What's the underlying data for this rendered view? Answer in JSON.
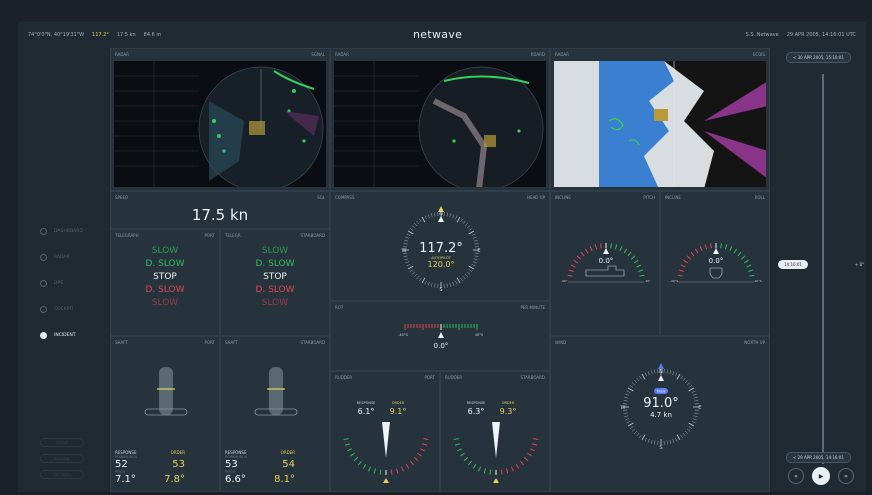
{
  "topbar": {
    "position": "74°0'0\"N, 40°19'31\"W",
    "heading": "117.2°",
    "speed": "17.5 kn",
    "depth": "84.6 m",
    "brand": "netwave",
    "vessel": "S.S. Netwave",
    "datetime": "29 APR 2005, 14:16:01 UTC"
  },
  "sidebar": {
    "items": [
      {
        "label": "DASHBOARD"
      },
      {
        "label": "RADAR"
      },
      {
        "label": "DPS"
      },
      {
        "label": "COCKPIT"
      },
      {
        "label": "INCIDENT"
      }
    ],
    "buttons": [
      "EVENT",
      "SECOND",
      "SETTINGS"
    ]
  },
  "radar": [
    {
      "title": "RADAR",
      "mode": "SGNAL"
    },
    {
      "title": "RADAR",
      "mode": "RDARD"
    },
    {
      "title": "RADAR",
      "mode": "ECDIS"
    }
  ],
  "speed": {
    "title": "SPEED",
    "ref": "SGL",
    "value": "17.5 kn"
  },
  "telegraph_port": {
    "title": "TELEGRAPH",
    "side": "PORT",
    "items": [
      "SLOW",
      "D. SLOW",
      "STOP",
      "D. SLOW",
      "SLOW"
    ]
  },
  "telegraph_stbd": {
    "title": "TELEGR.",
    "side": "STARBOARD",
    "items": [
      "SLOW",
      "D. SLOW",
      "STOP",
      "D. SLOW",
      "SLOW"
    ]
  },
  "compass": {
    "title": "COMPASS",
    "mode": "HEAD UP",
    "heading": "117.2°",
    "autopilot_label": "AUTOPILOT",
    "autopilot": "120.0°",
    "n": "N",
    "s": "S",
    "e": "E",
    "w": "W"
  },
  "rot": {
    "title": "ROT",
    "unit": "PER MINUTE",
    "value": "0.0°",
    "left": "-40°S",
    "right": "40°S"
  },
  "incline_pitch": {
    "title": "INCLINE",
    "mode": "PITCH",
    "value": "0.0°",
    "left": "-40°",
    "right": "40°"
  },
  "incline_roll": {
    "title": "INCLINE",
    "mode": "ROLL",
    "value": "0.0°",
    "left": "-40°S",
    "right": "40°S"
  },
  "shaft_port": {
    "title": "SHAFT",
    "side": "PORT",
    "response_label": "RESPONSE",
    "order_label": "ORDER",
    "power_label": "POWER IN %",
    "pitch_label": "PITCH",
    "power_resp": "52",
    "power_order": "53",
    "pitch_resp": "7.1°",
    "pitch_order": "7.8°"
  },
  "shaft_stbd": {
    "title": "SHAFT",
    "side": "STARBOARD",
    "response_label": "RESPONSE",
    "order_label": "ORDER",
    "power_label": "POWER IN %",
    "pitch_label": "PITCH",
    "power_resp": "53",
    "power_order": "54",
    "pitch_resp": "6.6°",
    "pitch_order": "8.1°"
  },
  "rudder_port": {
    "title": "RUDDER",
    "side": "PORT",
    "response_label": "RESPONSE",
    "order_label": "ORDER",
    "response": "6.1°",
    "order": "9.1°"
  },
  "rudder_stbd": {
    "title": "RUDDER",
    "side": "STARBOARD",
    "response_label": "RESPONSE",
    "order_label": "ORDER",
    "response": "6.3°",
    "order": "9.3°"
  },
  "wind": {
    "title": "WIND",
    "mode": "NORTH UP",
    "direction": "91.0°",
    "speed": "4.7 kn",
    "badge": "TRUE"
  },
  "timeline": {
    "top": "< 30 APR 2005, 15:10:01",
    "current": "14:16:01",
    "bottom": "< 29 APR 2005, 14:16:01",
    "edge": "+ 8°"
  },
  "colors": {
    "bg": "#1f2a33",
    "panel": "#26323c",
    "green": "#2fbf5a",
    "red": "#e0484f",
    "yellow": "#e8d25a"
  }
}
